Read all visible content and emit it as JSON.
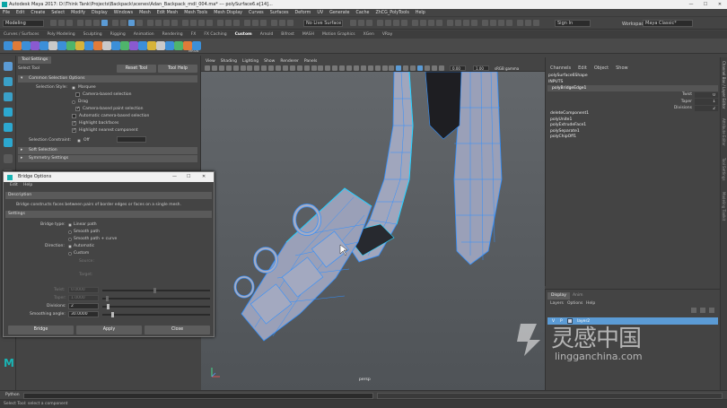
{
  "window": {
    "title": "Autodesk Maya 2017: D:\\Think Tank\\Projects\\Backpack\\scenes\\Adan_Backpack_mdl_004.ma*  ---  polySurface6.e[14]...",
    "min": "—",
    "max": "☐",
    "close": "✕"
  },
  "menubar": [
    "File",
    "Edit",
    "Create",
    "Select",
    "Modify",
    "Display",
    "Windows",
    "Mesh",
    "Edit Mesh",
    "Mesh Tools",
    "Mesh Display",
    "Curves",
    "Surfaces",
    "Deform",
    "UV",
    "Generate",
    "Cache",
    "ZhCG_PolyTools",
    "Help"
  ],
  "statusline": {
    "mode": "Modeling",
    "live_surface": "No Live Surface",
    "sign_in": "Sign In",
    "workspace_label": "Workspace :",
    "workspace": "Maya Classic*"
  },
  "shelf_tabs": [
    "Curves / Surfaces",
    "Poly Modeling",
    "Sculpting",
    "Rigging",
    "Animation",
    "Rendering",
    "FX",
    "FX Caching",
    "Custom",
    "Arnold",
    "Bifrost",
    "MASH",
    "Motion Graphics",
    "XGen",
    "VRay"
  ],
  "shelf_active": "Custom",
  "shelf_icon_label": "MRSW",
  "tool_settings": {
    "tab": "Tool Settings",
    "tool_name": "Select Tool",
    "reset_button": "Reset Tool",
    "help_button": "Tool Help",
    "section_common": "Common Selection Options",
    "selection_style_label": "Selection Style:",
    "opt_marquee": "Marquee",
    "opt_camera_marquee": "Camera-based selection",
    "opt_drag": "Drag",
    "opt_camera_paint": "Camera-based paint selection",
    "opt_auto_camera": "Automatic camera-based selection",
    "opt_highlight_backfaces": "Highlight backfaces",
    "opt_highlight_nearest": "Highlight nearest component",
    "selection_constraint_label": "Selection Constraint:",
    "selection_constraint_value": "Off",
    "section_soft": "Soft Selection",
    "section_symmetry": "Symmetry Settings"
  },
  "bridge_options": {
    "title": "Bridge Options",
    "menu": [
      "Edit",
      "Help"
    ],
    "description_header": "Description",
    "description": "Bridge constructs faces between pairs of border edges or faces on a single mesh.",
    "settings_header": "Settings",
    "bridge_type_label": "Bridge type:",
    "opt_linear": "Linear path",
    "opt_smooth": "Smooth path",
    "opt_smooth_curve": "Smooth path + curve",
    "direction_label": "Direction:",
    "opt_automatic": "Automatic",
    "opt_custom": "Custom",
    "source_label": "Source:",
    "target_label": "Target:",
    "twist_label": "Twist:",
    "twist_value": "0.0000",
    "taper_label": "Taper:",
    "taper_value": "1.0000",
    "divisions_label": "Divisions:",
    "divisions_value": "2",
    "smoothing_label": "Smoothing angle:",
    "smoothing_value": "30.0000",
    "btn_bridge": "Bridge",
    "btn_apply": "Apply",
    "btn_close": "Close"
  },
  "viewport": {
    "menu": [
      "View",
      "Shading",
      "Lighting",
      "Show",
      "Renderer",
      "Panels"
    ],
    "field_a": "0.00",
    "field_b": "1.00",
    "colorspace": "sRGB gamma",
    "hud_symmetry": "Symmetry: pCube12",
    "camera": "persp"
  },
  "channel_box": {
    "menu": [
      "Channels",
      "Edit",
      "Object",
      "Show"
    ],
    "object": "polySurface6Shape",
    "inputs_label": "INPUTS",
    "node": "polyBridgeEdge1",
    "attrs": [
      {
        "name": "Twist",
        "value": "0"
      },
      {
        "name": "Taper",
        "value": "1"
      },
      {
        "name": "Divisions",
        "value": "2"
      }
    ],
    "history": [
      "deleteComponent1",
      "polyUnite1",
      "polyExtrudeFace1",
      "polySeparate1",
      "polyChipOff1"
    ]
  },
  "layer_editor": {
    "tabs": [
      "Display",
      "Anim"
    ],
    "menu": [
      "Layers",
      "Options",
      "Help"
    ],
    "layer": {
      "vis": "V",
      "ref": "P",
      "name": "layer2"
    }
  },
  "right_strip": [
    "Channel Box / Layer Editor",
    "Attribute Editor",
    "Tool Settings",
    "Modeling Toolkit"
  ],
  "command_line": {
    "label": "Python"
  },
  "help_line": {
    "text": "Select Tool: select a component"
  },
  "watermark": {
    "cn": "灵感中国",
    "url": "lingganchina.com"
  },
  "colors": {
    "accent": "#5b9bd5",
    "wire_blue": "#2f8fff",
    "wire_cyan": "#27d6ff",
    "mesh": "#9aa0b8"
  }
}
